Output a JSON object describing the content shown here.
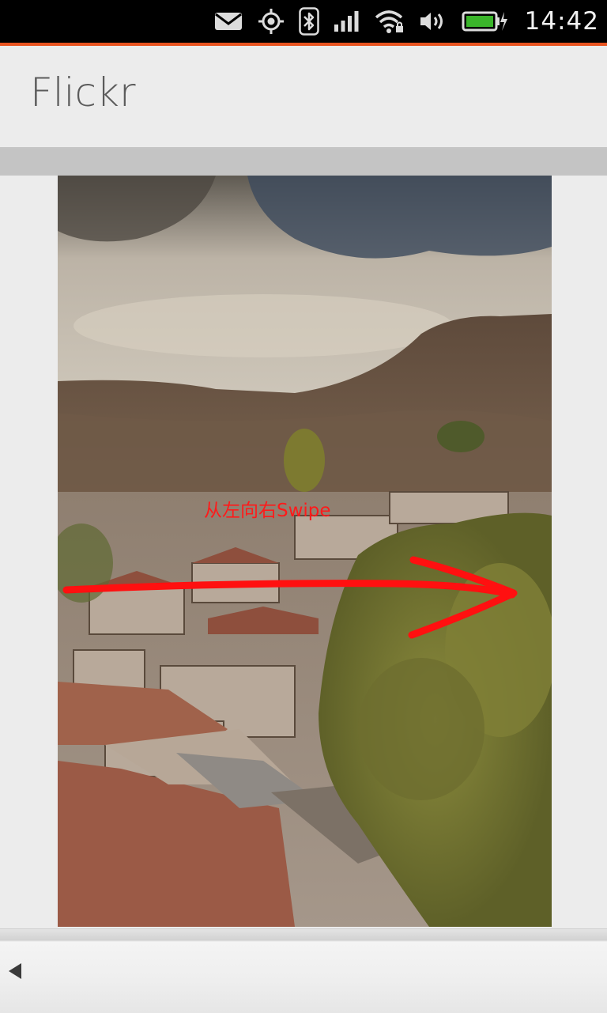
{
  "status_bar": {
    "time": "14:42",
    "icons": [
      "mail-icon",
      "location-icon",
      "bluetooth-icon",
      "signal-icon",
      "wifi-icon",
      "volume-icon",
      "battery-charging-icon"
    ],
    "accent_color": "#e95420"
  },
  "header": {
    "title": "Flickr"
  },
  "photo": {
    "description_icon": "photo-image"
  },
  "annotation": {
    "text": "从左向右Swipe",
    "color": "#ff1a1a"
  },
  "toolbar": {
    "back_icon": "back-triangle-icon"
  }
}
